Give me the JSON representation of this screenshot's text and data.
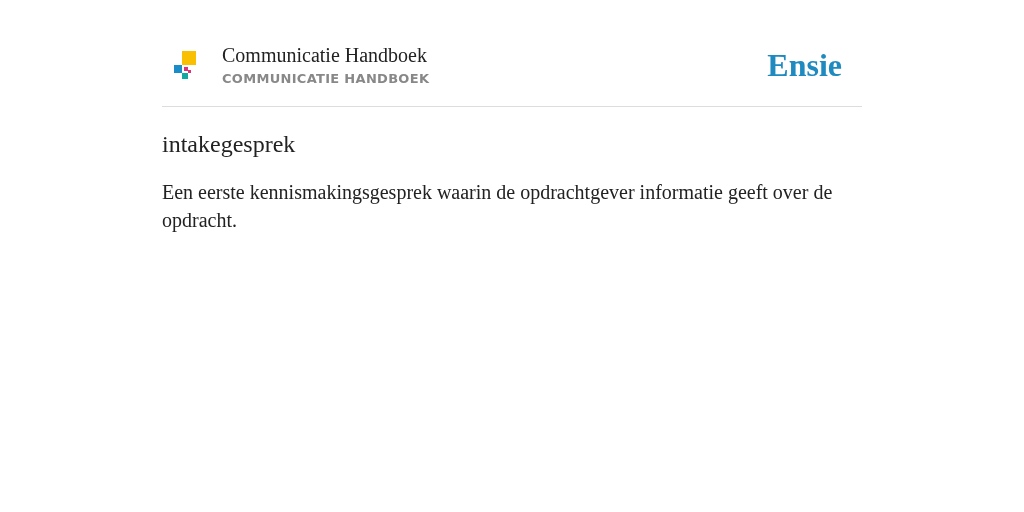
{
  "header": {
    "title": "Communicatie Handboek",
    "subtitle": "COMMUNICATIE HANDBOEK",
    "brand": "Ensie"
  },
  "entry": {
    "term": "intakegesprek",
    "definition": "Een eerste kennismakingsgesprek waarin de opdrachtgever informatie geeft over de opdracht."
  }
}
